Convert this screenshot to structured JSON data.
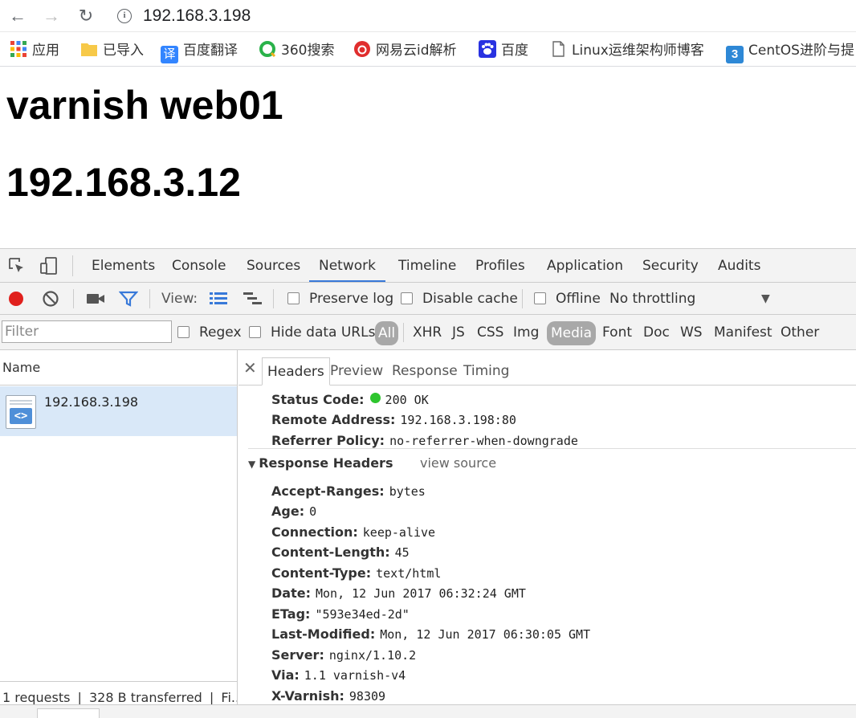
{
  "browser": {
    "url": "192.168.3.198",
    "bookmarks": [
      {
        "label": "应用",
        "icon": "apps-grid-icon",
        "color": "#4285f4"
      },
      {
        "label": "已导入",
        "icon": "folder-icon",
        "color": "#f7c948"
      },
      {
        "label": "百度翻译",
        "icon": "baidu-translate-icon",
        "color": "#3385ff",
        "glyph": "译"
      },
      {
        "label": "360搜索",
        "icon": "search-360-icon",
        "color": "#2ab24a"
      },
      {
        "label": "网易云id解析",
        "icon": "netease-music-icon",
        "color": "#e02d2d"
      },
      {
        "label": "百度",
        "icon": "baidu-paw-icon",
        "color": "#2932e1"
      },
      {
        "label": "Linux运维架构师博客",
        "icon": "page-icon",
        "color": "#888888"
      },
      {
        "label": "CentOS进阶与提",
        "icon": "app-3-icon",
        "color": "#2e88d6"
      }
    ]
  },
  "page": {
    "title": "varnish web01",
    "ip": "192.168.3.12"
  },
  "devtools": {
    "tabs": [
      "Elements",
      "Console",
      "Sources",
      "Network",
      "Timeline",
      "Profiles",
      "Application",
      "Security",
      "Audits"
    ],
    "active_tab": "Network",
    "toolbar": {
      "view_label": "View:",
      "preserve_log": "Preserve log",
      "disable_cache": "Disable cache",
      "offline": "Offline",
      "throttling": "No throttling"
    },
    "filter": {
      "placeholder": "Filter",
      "regex": "Regex",
      "hide_data_urls": "Hide data URLs",
      "types": [
        "All",
        "XHR",
        "JS",
        "CSS",
        "Img",
        "Media",
        "Font",
        "Doc",
        "WS",
        "Manifest",
        "Other"
      ]
    },
    "requests": {
      "column": "Name",
      "items": [
        {
          "name": "192.168.3.198"
        }
      ],
      "summary": "1 requests  ❘  328 B transferred  ❘  Fi..."
    },
    "details": {
      "tabs": [
        "Headers",
        "Preview",
        "Response",
        "Timing"
      ],
      "active_tab": "Headers",
      "general": [
        {
          "key": "Status Code:",
          "value": "200 OK"
        },
        {
          "key": "Remote Address:",
          "value": "192.168.3.198:80"
        },
        {
          "key": "Referrer Policy:",
          "value": "no-referrer-when-downgrade"
        }
      ],
      "response_headers_title": "Response Headers",
      "view_source": "view source",
      "response_headers": [
        {
          "key": "Accept-Ranges:",
          "value": "bytes"
        },
        {
          "key": "Age:",
          "value": "0"
        },
        {
          "key": "Connection:",
          "value": "keep-alive"
        },
        {
          "key": "Content-Length:",
          "value": "45"
        },
        {
          "key": "Content-Type:",
          "value": "text/html"
        },
        {
          "key": "Date:",
          "value": "Mon, 12 Jun 2017 06:32:24 GMT"
        },
        {
          "key": "ETag:",
          "value": "\"593e34ed-2d\""
        },
        {
          "key": "Last-Modified:",
          "value": "Mon, 12 Jun 2017 06:30:05 GMT"
        },
        {
          "key": "Server:",
          "value": "nginx/1.10.2"
        },
        {
          "key": "Via:",
          "value": "1.1 varnish-v4"
        },
        {
          "key": "X-Varnish:",
          "value": "98309"
        }
      ]
    }
  }
}
